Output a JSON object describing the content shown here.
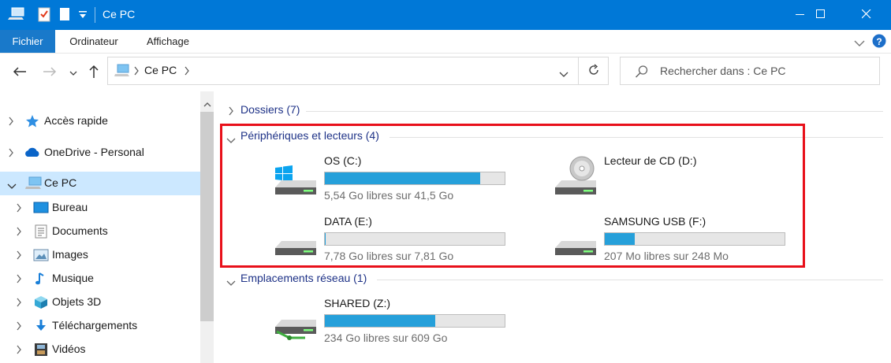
{
  "window": {
    "title": "Ce PC",
    "minimize_icon": "minimize-icon",
    "maximize_icon": "maximize-icon",
    "close_icon": "close-icon"
  },
  "ribbon": {
    "tabs": [
      "Fichier",
      "Ordinateur",
      "Affichage"
    ]
  },
  "address": {
    "path": "Ce PC",
    "search_placeholder": "Rechercher dans : Ce PC"
  },
  "nav": {
    "items": [
      {
        "label": "Accès rapide"
      },
      {
        "label": "OneDrive - Personal"
      },
      {
        "label": "Ce PC"
      },
      {
        "label": "Bureau"
      },
      {
        "label": "Documents"
      },
      {
        "label": "Images"
      },
      {
        "label": "Musique"
      },
      {
        "label": "Objets 3D"
      },
      {
        "label": "Téléchargements"
      },
      {
        "label": "Vidéos"
      }
    ]
  },
  "content": {
    "groups": {
      "folders": "Dossiers (7)",
      "devices": "Périphériques et lecteurs (4)",
      "network": "Emplacements réseau (1)"
    },
    "drives": [
      {
        "name": "OS (C:)",
        "free": "5,54 Go libres sur 41,5 Go",
        "used_fraction": 0.866
      },
      {
        "name": "Lecteur de CD (D:)"
      },
      {
        "name": "DATA (E:)",
        "free": "7,78 Go libres sur 7,81 Go",
        "used_fraction": 0.004
      },
      {
        "name": "SAMSUNG USB (F:)",
        "free": "207 Mo libres sur 248 Mo",
        "used_fraction": 0.165
      }
    ],
    "network": [
      {
        "name": "SHARED (Z:)",
        "free": "234 Go libres sur 609 Go",
        "used_fraction": 0.616
      }
    ]
  },
  "colors": {
    "titlebar": "#0078d7",
    "bar_fill": "#26a0da",
    "selection": "#cce8ff",
    "highlight": "#e8101a",
    "group_header": "#1e3287"
  }
}
